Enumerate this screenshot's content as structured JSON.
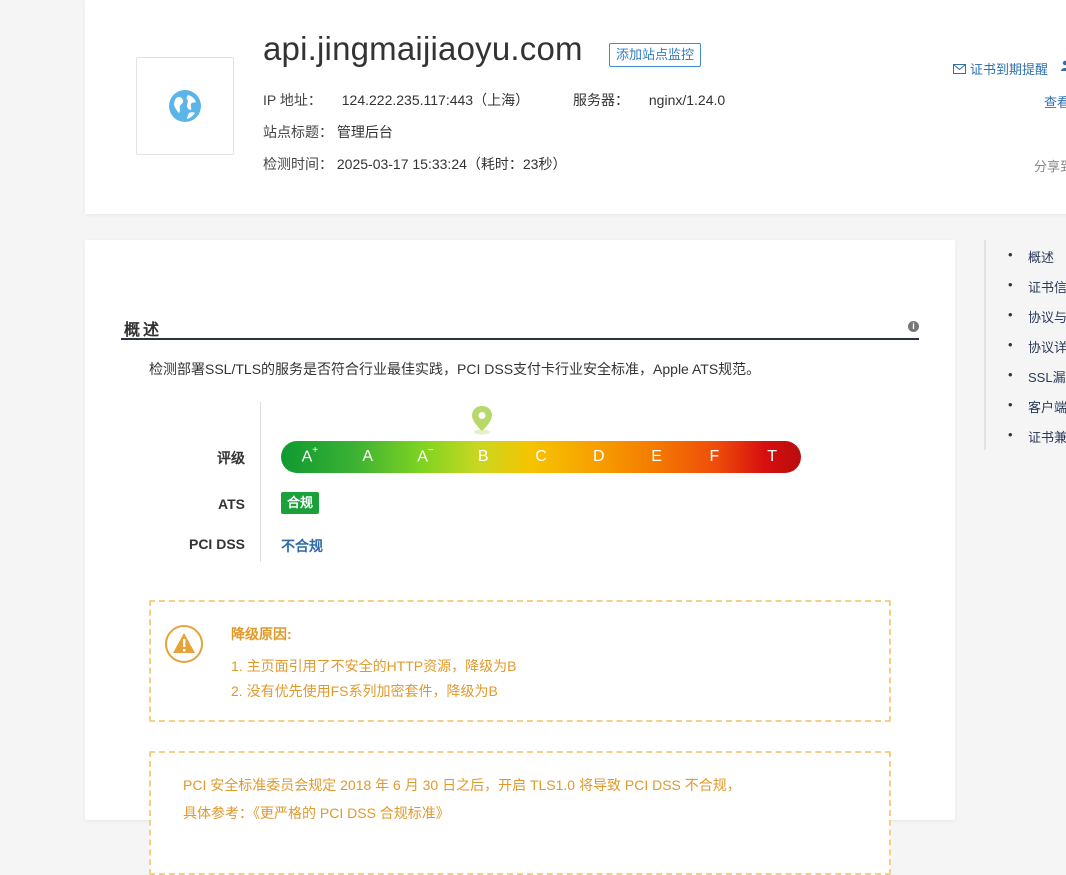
{
  "header": {
    "domain": "api.jingmaijiaoyu.com",
    "add_monitor": "添加站点监控",
    "ip_label": "IP 地址：",
    "ip_value": "124.222.235.117:443（上海）",
    "server_label": "服务器：",
    "server_value": "nginx/1.24.0",
    "title_label": "站点标题：",
    "title_value": "管理后台",
    "time_label": "检测时间：",
    "time_value": "2025-03-17 15:33:24（耗时：23秒）",
    "remind_label": "证书到期提醒",
    "view_label": "查看",
    "share_label": "分享到"
  },
  "overview": {
    "title": "概述",
    "description": "检测部署SSL/TLS的服务是否符合行业最佳实践，PCI DSS支付卡行业安全标准，Apple ATS规范。",
    "rating_label": "评级",
    "grades": [
      {
        "base": "A",
        "sup": "+"
      },
      {
        "base": "A",
        "sup": ""
      },
      {
        "base": "A",
        "sup": "−"
      },
      {
        "base": "B",
        "sup": ""
      },
      {
        "base": "C",
        "sup": ""
      },
      {
        "base": "D",
        "sup": ""
      },
      {
        "base": "E",
        "sup": ""
      },
      {
        "base": "F",
        "sup": ""
      },
      {
        "base": "T",
        "sup": ""
      }
    ],
    "current_grade": "B",
    "ats_label": "ATS",
    "ats_value": "合规",
    "pci_label": "PCI DSS",
    "pci_value": "不合规"
  },
  "downgrade": {
    "title": "降级原因:",
    "items": [
      "1. 主页面引用了不安全的HTTP资源，降级为B",
      "2. 没有优先使用FS系列加密套件，降级为B"
    ]
  },
  "pci_notice": {
    "line1": "PCI 安全标准委员会规定 2018 年 6 月 30 日之后，开启 TLS1.0 将导致 PCI DSS 不合规，",
    "line2": "具体参考：《更严格的 PCI DSS 合规标准》"
  },
  "toc": [
    "概述",
    "证书信",
    "协议与",
    "协议详",
    "SSL漏",
    "客户端",
    "证书兼"
  ],
  "colors": {
    "accent_blue": "#2f7cc7",
    "ats_green": "#1aa13a",
    "warn_orange": "#e09a2c",
    "pin_green": "#b7d96a"
  }
}
